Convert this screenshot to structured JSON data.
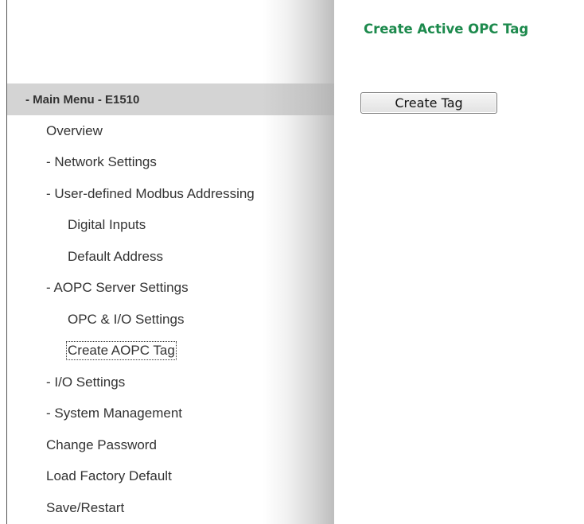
{
  "sidebar": {
    "header": "- Main Menu - E1510",
    "items": [
      {
        "label": "Overview"
      },
      {
        "label": "- Network Settings"
      },
      {
        "label": "- User-defined Modbus Addressing"
      },
      {
        "label": "Digital Inputs"
      },
      {
        "label": "Default Address"
      },
      {
        "label": "- AOPC Server Settings"
      },
      {
        "label": "OPC & I/O Settings"
      },
      {
        "label": "Create AOPC Tag"
      },
      {
        "label": "- I/O Settings"
      },
      {
        "label": "- System Management"
      },
      {
        "label": "Change Password"
      },
      {
        "label": "Load Factory Default"
      },
      {
        "label": "Save/Restart"
      }
    ]
  },
  "content": {
    "title": "Create Active OPC Tag",
    "create_button_label": "Create Tag"
  },
  "colors": {
    "title_green": "#1d8a4d",
    "header_gray": "#d4d4d4"
  }
}
